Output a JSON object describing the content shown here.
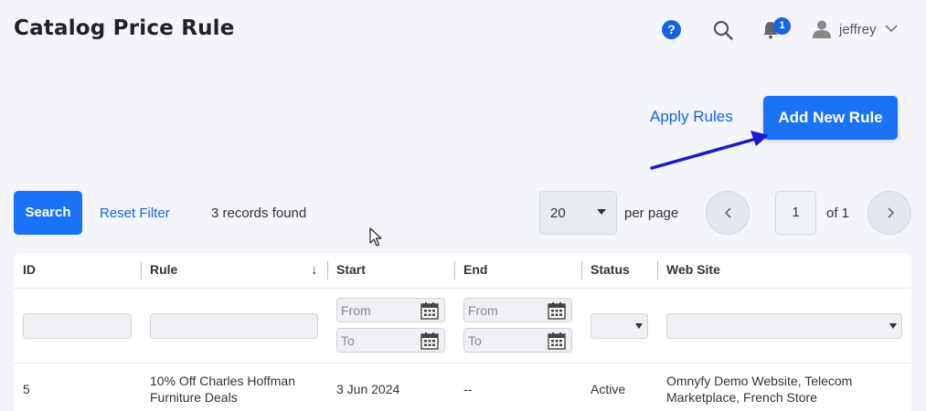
{
  "header": {
    "title": "Catalog Price Rule",
    "help_label": "?",
    "notification_count": "1",
    "username": "jeffrey"
  },
  "actions": {
    "apply_rules": "Apply Rules",
    "add_new_rule": "Add New Rule"
  },
  "toolbar": {
    "search_label": "Search",
    "reset_filter_label": "Reset Filter",
    "records_found": "3 records found",
    "page_size": "20",
    "per_page_label": "per page",
    "current_page": "1",
    "of_total": "of 1"
  },
  "grid": {
    "columns": [
      "ID",
      "Rule",
      "Start",
      "End",
      "Status",
      "Web Site"
    ],
    "sort_indicator": "↓",
    "filters": {
      "from_placeholder": "From",
      "to_placeholder": "To"
    },
    "rows": [
      {
        "id": "5",
        "rule_line1": "10% Off Charles Hoffman",
        "rule_line2": "Furniture Deals",
        "start": "3 Jun 2024",
        "end": "--",
        "status": "Active",
        "website_line1": "Omnyfy Demo Website, Telecom",
        "website_line2": "Marketplace, French Store"
      }
    ]
  },
  "colors": {
    "primary": "#1a73f5",
    "link": "#1565e0",
    "background": "#f3f5fa",
    "annotation_arrow": "#1a1acc"
  }
}
